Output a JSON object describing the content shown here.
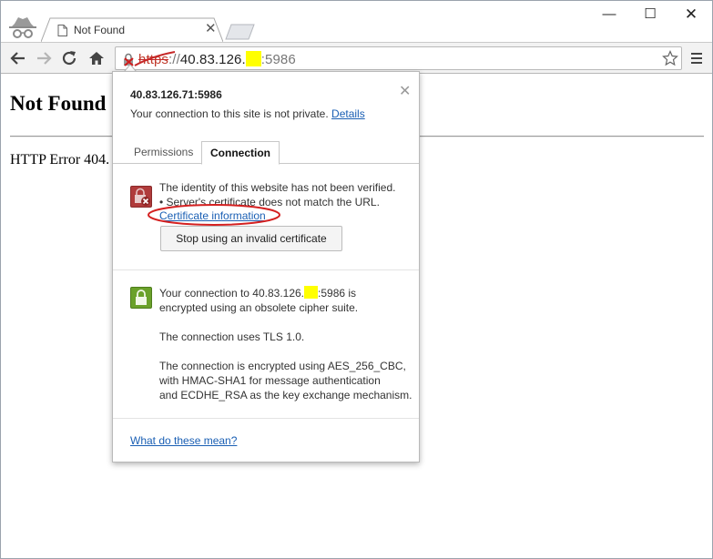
{
  "window": {
    "controls": {
      "minimize": "—",
      "maximize": "☐",
      "close": "✕"
    }
  },
  "tab": {
    "title": "Not Found",
    "close": "✕"
  },
  "toolbar": {
    "url_scheme": "https",
    "url_sep": "://",
    "url_host_prefix": "40.83.126.",
    "url_port": ":5986"
  },
  "page": {
    "heading": "Not Found",
    "body": "HTTP Error 404."
  },
  "popup": {
    "host": "40.83.126.71:5986",
    "close": "✕",
    "subtitle": "Your connection to this site is not private.",
    "details_link": "Details",
    "tabs": [
      {
        "label": "Permissions",
        "active": false
      },
      {
        "label": "Connection",
        "active": true
      }
    ],
    "identity": {
      "line1": "The identity of this website has not been verified.",
      "line2": "• Server's certificate does not match the URL.",
      "cert_link": "Certificate information",
      "stop_button": "Stop using an invalid certificate"
    },
    "connection": {
      "line1_prefix": "Your connection to 40.83.126.",
      "line1_suffix": ":5986 is",
      "line2": "encrypted using an obsolete cipher suite.",
      "tls": "The connection uses TLS 1.0.",
      "cipher1": "The connection is encrypted using AES_256_CBC,",
      "cipher2": "with HMAC-SHA1 for message authentication",
      "cipher3": "and ECDHE_RSA as the key exchange mechanism."
    },
    "footer_link": "What do these mean?"
  },
  "colors": {
    "redaction": "#ffff00",
    "annotation": "#d42020",
    "warning_icon": "#b03b3b",
    "lock_icon": "#6aa12a",
    "link": "#1a5fb4"
  }
}
